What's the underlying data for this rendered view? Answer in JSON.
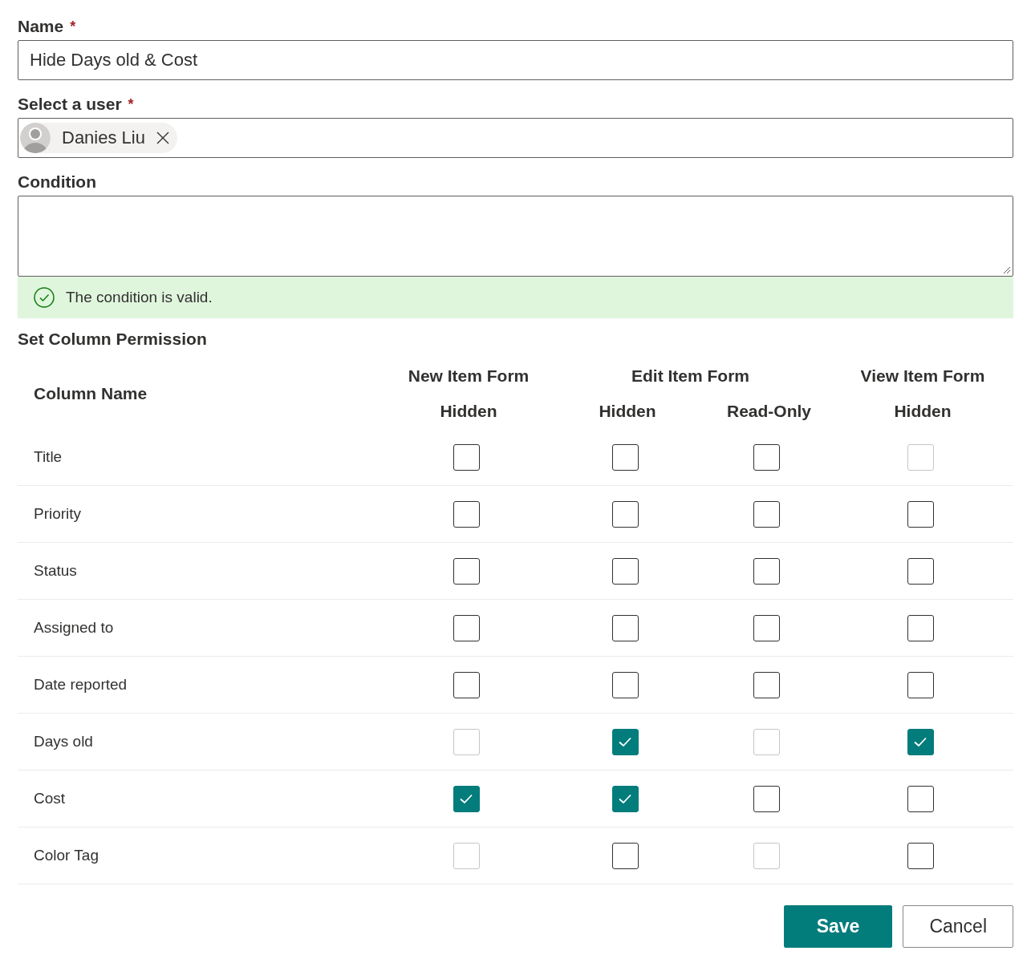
{
  "name_field": {
    "label": "Name",
    "required_mark": "*",
    "value": "Hide Days old & Cost"
  },
  "user_field": {
    "label": "Select a user",
    "required_mark": "*",
    "chips": [
      {
        "name": "Danies Liu"
      }
    ]
  },
  "condition_field": {
    "label": "Condition"
  },
  "validation": {
    "message": "The condition is valid."
  },
  "permissions": {
    "title": "Set Column Permission",
    "column_header": "Column Name",
    "form_groups": [
      {
        "label": "New Item Form",
        "subcolumns": [
          "Hidden"
        ]
      },
      {
        "label": "Edit Item Form",
        "subcolumns": [
          "Hidden",
          "Read-Only"
        ]
      },
      {
        "label": "View Item Form",
        "subcolumns": [
          "Hidden"
        ]
      }
    ],
    "rows": [
      {
        "name": "Title",
        "cells": [
          {
            "checked": false,
            "disabled": false
          },
          {
            "checked": false,
            "disabled": false
          },
          {
            "checked": false,
            "disabled": false
          },
          {
            "checked": false,
            "disabled": true
          }
        ]
      },
      {
        "name": "Priority",
        "cells": [
          {
            "checked": false,
            "disabled": false
          },
          {
            "checked": false,
            "disabled": false
          },
          {
            "checked": false,
            "disabled": false
          },
          {
            "checked": false,
            "disabled": false
          }
        ]
      },
      {
        "name": "Status",
        "cells": [
          {
            "checked": false,
            "disabled": false
          },
          {
            "checked": false,
            "disabled": false
          },
          {
            "checked": false,
            "disabled": false
          },
          {
            "checked": false,
            "disabled": false
          }
        ]
      },
      {
        "name": "Assigned to",
        "cells": [
          {
            "checked": false,
            "disabled": false
          },
          {
            "checked": false,
            "disabled": false
          },
          {
            "checked": false,
            "disabled": false
          },
          {
            "checked": false,
            "disabled": false
          }
        ]
      },
      {
        "name": "Date reported",
        "cells": [
          {
            "checked": false,
            "disabled": false
          },
          {
            "checked": false,
            "disabled": false
          },
          {
            "checked": false,
            "disabled": false
          },
          {
            "checked": false,
            "disabled": false
          }
        ]
      },
      {
        "name": "Days old",
        "cells": [
          {
            "checked": false,
            "disabled": true
          },
          {
            "checked": true,
            "disabled": false
          },
          {
            "checked": false,
            "disabled": true
          },
          {
            "checked": true,
            "disabled": false
          }
        ]
      },
      {
        "name": "Cost",
        "cells": [
          {
            "checked": true,
            "disabled": false
          },
          {
            "checked": true,
            "disabled": false
          },
          {
            "checked": false,
            "disabled": false
          },
          {
            "checked": false,
            "disabled": false
          }
        ]
      },
      {
        "name": "Color Tag",
        "cells": [
          {
            "checked": false,
            "disabled": true
          },
          {
            "checked": false,
            "disabled": false
          },
          {
            "checked": false,
            "disabled": true
          },
          {
            "checked": false,
            "disabled": false
          }
        ]
      }
    ]
  },
  "buttons": [
    {
      "label": "Save",
      "kind": "primary"
    },
    {
      "label": "Cancel",
      "kind": "default"
    }
  ]
}
